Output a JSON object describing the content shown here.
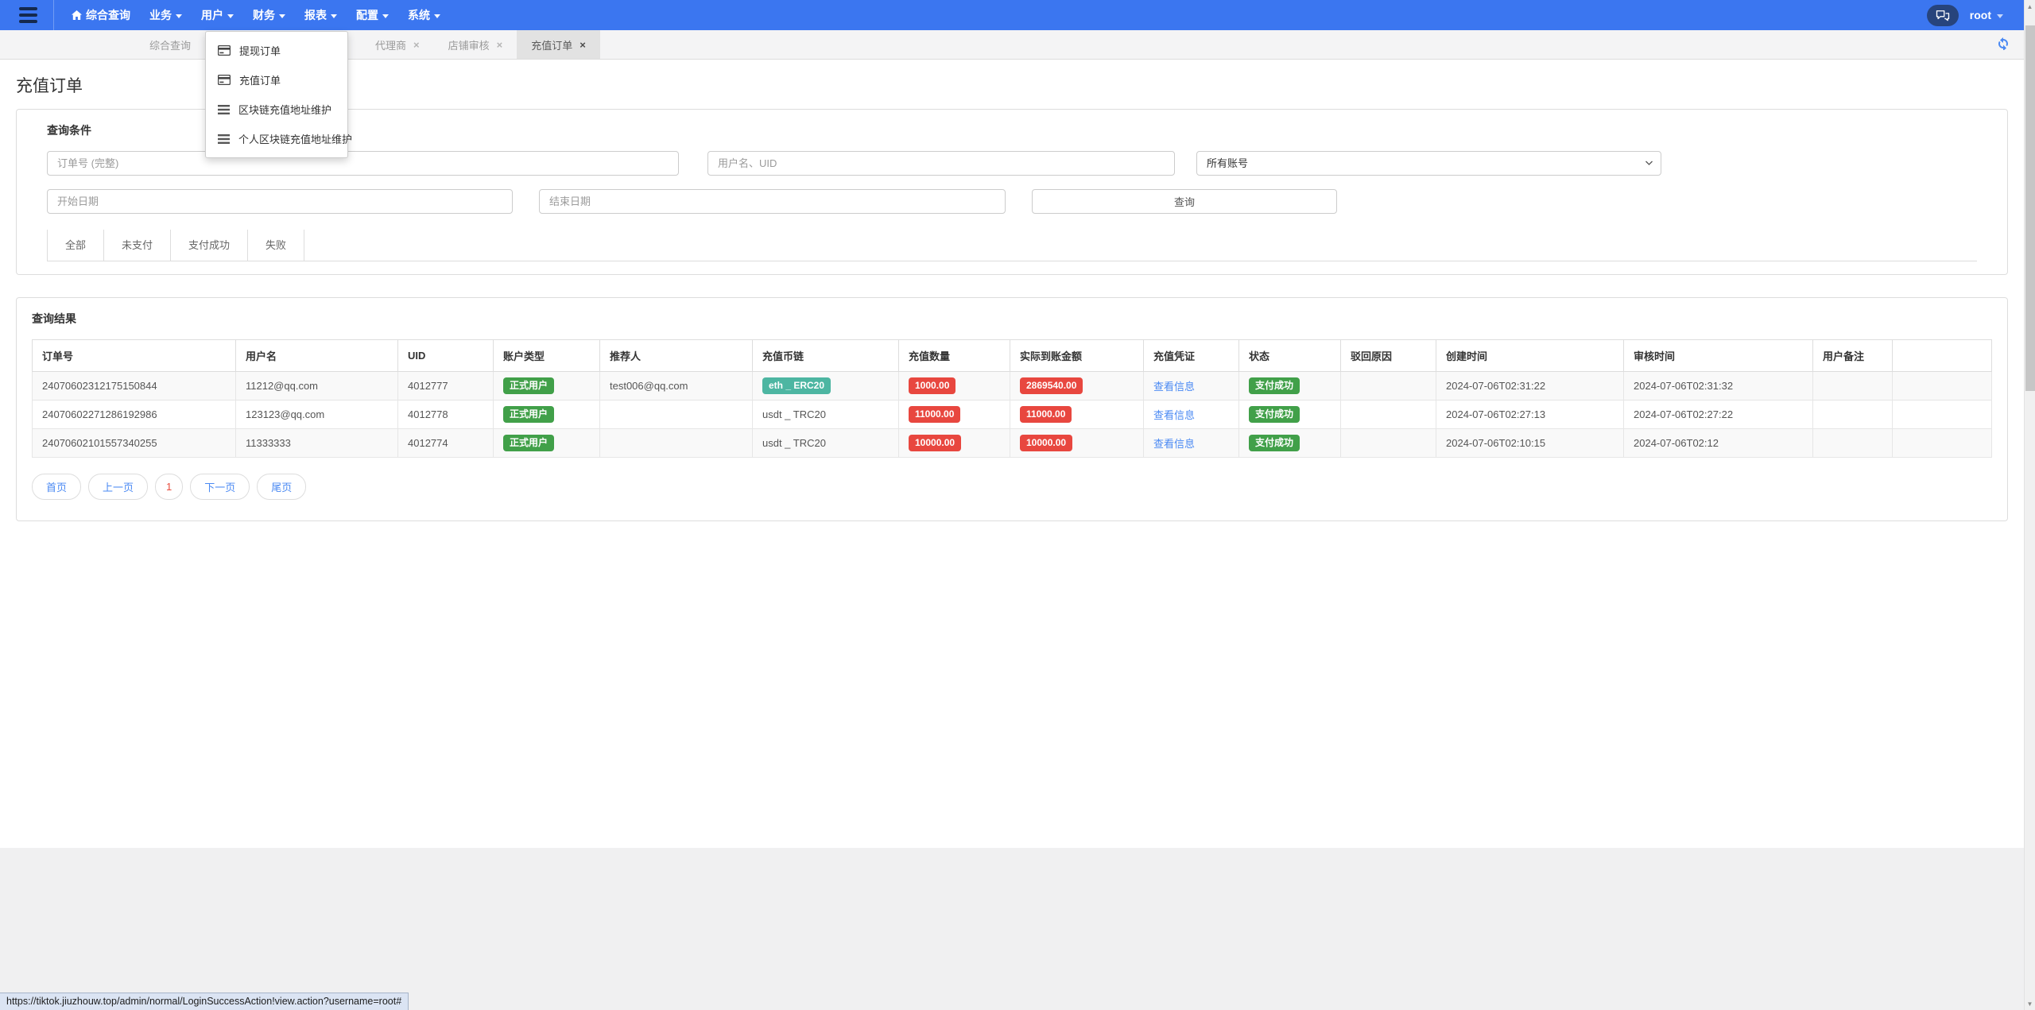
{
  "colors": {
    "navbar_blue": "#3b76f0",
    "accent_blue": "#4a89f3",
    "badge_green": "#41a049",
    "badge_red": "#e8473f",
    "badge_teal": "#4db6a2",
    "current_page_red": "#e84c3d"
  },
  "navbar": {
    "menu": [
      {
        "label": "综合查询",
        "icon": "home-icon"
      },
      {
        "label": "业务"
      },
      {
        "label": "用户"
      },
      {
        "label": "财务"
      },
      {
        "label": "报表"
      },
      {
        "label": "配置"
      },
      {
        "label": "系统"
      }
    ],
    "username": "root"
  },
  "tabbar": {
    "tabs": [
      {
        "label": "综合查询",
        "closable": false
      },
      {
        "label": "",
        "closable": true
      },
      {
        "label": "代理商",
        "closable": true
      },
      {
        "label": "店铺审核",
        "closable": true
      },
      {
        "label": "充值订单",
        "closable": true,
        "active": true
      }
    ],
    "close_glyph": "×"
  },
  "dropdown": {
    "items": [
      {
        "icon": "credit-card-icon",
        "label": "提现订单"
      },
      {
        "icon": "credit-card-icon",
        "label": "充值订单"
      },
      {
        "icon": "list-icon",
        "label": "区块链充值地址维护"
      },
      {
        "icon": "list-icon",
        "label": "个人区块链充值地址维护"
      }
    ]
  },
  "page": {
    "title": "充值订单"
  },
  "query": {
    "panel_title": "查询条件",
    "order_placeholder": "订单号 (完整)",
    "user_placeholder": "用户名、UID",
    "account_select_value": "所有账号",
    "start_placeholder": "开始日期",
    "end_placeholder": "结束日期",
    "search_button": "查询",
    "status_tabs": [
      "全部",
      "未支付",
      "支付成功",
      "失败"
    ]
  },
  "results": {
    "panel_title": "查询结果",
    "columns": [
      "订单号",
      "用户名",
      "UID",
      "账户类型",
      "推荐人",
      "充值币链",
      "充值数量",
      "实际到账金额",
      "充值凭证",
      "状态",
      "驳回原因",
      "创建时间",
      "审核时间",
      "用户备注",
      ""
    ],
    "rows": [
      {
        "order_no": "24070602312175150844",
        "username": "11212@qq.com",
        "uid": "4012777",
        "account_type": "正式用户",
        "referrer": "test006@qq.com",
        "chain": "eth _ ERC20",
        "amount": "1000.00",
        "actual": "2869540.00",
        "voucher": "查看信息",
        "status": "支付成功",
        "reject_reason": "",
        "created": "2024-07-06T02:31:22",
        "audited": "2024-07-06T02:31:32",
        "remark": ""
      },
      {
        "order_no": "24070602271286192986",
        "username": "123123@qq.com",
        "uid": "4012778",
        "account_type": "正式用户",
        "referrer": "",
        "chain": "usdt _ TRC20",
        "amount": "11000.00",
        "actual": "11000.00",
        "voucher": "查看信息",
        "status": "支付成功",
        "reject_reason": "",
        "created": "2024-07-06T02:27:13",
        "audited": "2024-07-06T02:27:22",
        "remark": ""
      },
      {
        "order_no": "24070602101557340255",
        "username": "11333333",
        "uid": "4012774",
        "account_type": "正式用户",
        "referrer": "",
        "chain": "usdt _ TRC20",
        "amount": "10000.00",
        "actual": "10000.00",
        "voucher": "查看信息",
        "status": "支付成功",
        "reject_reason": "",
        "created": "2024-07-06T02:10:15",
        "audited": "2024-07-06T02:12",
        "remark": ""
      }
    ],
    "pagination": [
      "首页",
      "上一页",
      "1",
      "下一页",
      "尾页"
    ]
  },
  "statusbar": {
    "url": "https://tiktok.jiuzhouw.top/admin/normal/LoginSuccessAction!view.action?username=root#"
  }
}
